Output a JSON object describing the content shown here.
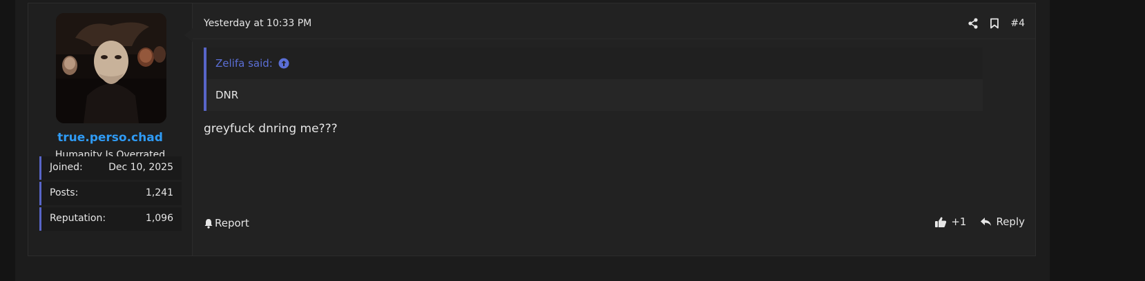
{
  "user": {
    "avatar_alt": "masked figures avatar",
    "username": "true.perso.chad",
    "title": "Humanity Is Overrated",
    "stats": [
      {
        "label": "Joined:",
        "value": "Dec 10, 2025"
      },
      {
        "label": "Posts:",
        "value": "1,241"
      },
      {
        "label": "Reputation:",
        "value": "1,096"
      }
    ]
  },
  "post": {
    "date": "Yesterday at 10:33 PM",
    "number": "#4",
    "quote": {
      "author": "Zelifa said:",
      "text": "DNR"
    },
    "message": "greyfuck dnring me???",
    "report_label": "Report",
    "like_count": "+1",
    "reply_label": "Reply"
  },
  "icons": {
    "share": "share-icon",
    "bookmark": "bookmark-icon",
    "quote_jump": "arrow-up-circle-icon",
    "report": "bell-icon",
    "like": "thumbs-up-icon",
    "reply": "reply-arrow-icon"
  },
  "colors": {
    "accent": "#5865c8",
    "username": "#2f9bf5",
    "quote_author": "#5b6fd6",
    "background": "#141414",
    "post_bg": "#222222"
  }
}
